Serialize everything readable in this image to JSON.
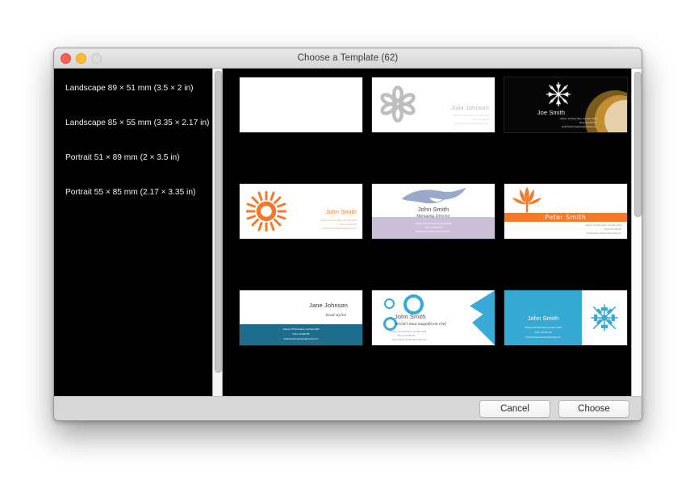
{
  "window": {
    "title": "Choose a Template (62)",
    "traffic_lights": [
      "close-button",
      "minimize-button",
      "zoom-button"
    ]
  },
  "sidebar": {
    "items": [
      {
        "label": "Landscape 89 × 51 mm (3.5 × 2 in)"
      },
      {
        "label": "Landscape 85 × 55 mm (3.35 × 2.17 in)"
      },
      {
        "label": "Portrait 51 × 89 mm (2 × 3.5 in)"
      },
      {
        "label": "Portrait 55 × 85 mm (2.17 × 3.35 in)"
      }
    ]
  },
  "common": {
    "address": "Address:  123 Street Name, City State 12345",
    "phone": "Phone: 123-456-789",
    "email": "Email: firstname.lastname@company.com"
  },
  "templates": [
    {
      "id": "blank",
      "name": "",
      "subtitle": "",
      "icon": "none",
      "accent": "#ffffff"
    },
    {
      "id": "julia-flower",
      "name": "Julia Johnson",
      "subtitle": "",
      "icon": "flower-icon",
      "accent": "#bcbcbc",
      "address": "Address:  123 Street Name, City State 12345",
      "phone": "Phone: 123-456-789",
      "email": "Email: firstname.lastname@company.com"
    },
    {
      "id": "joe-snowflake-dark",
      "name": "Joe Smith",
      "subtitle": "",
      "icon": "snowflake-icon",
      "accent": "#c79a44",
      "address": "Address:  123 Street Name, City State 12345",
      "phone": "Phone: 123-456-789",
      "email": "Email: firstname.lastname@company.com"
    },
    {
      "id": "john-sunburst",
      "name": "John Smith",
      "subtitle": "",
      "icon": "sunburst-icon",
      "accent": "#f0823c",
      "address": "Address:  123 Street Name, City State 12345",
      "phone": "Phone: 123-456-789",
      "email": "Email: firstname.lastname@company.com"
    },
    {
      "id": "john-feather-lavender",
      "name": "John Smith",
      "subtitle": "Managing Director",
      "icon": "feather-icon",
      "accent": "#ccbfd8",
      "address": "Address:  123 Street Name, City State 12345",
      "phone": "Phone: 123-456-789",
      "email": "Email: firstname.lastname@company.com"
    },
    {
      "id": "peter-lotus",
      "name": "Peter Smith",
      "subtitle": "",
      "icon": "lotus-icon",
      "accent": "#f4792a",
      "address": "Address:  123 Street Name, City State 12345",
      "phone": "Phone: 123-456-789",
      "email": "Email: firstname.lastname@company.com"
    },
    {
      "id": "jane-teal",
      "name": "Jane Johnson",
      "subtitle": "head stylist",
      "icon": "none",
      "accent": "#1d6e8c",
      "address": "Address:  123 Street Name, City State 12345",
      "phone": "Phone: 123-456-789",
      "email": "Email: firstname.lastname@company.com"
    },
    {
      "id": "john-circles-chef",
      "name": "John Smith",
      "subtitle": "World's most magnificent chef",
      "icon": "circles-icon",
      "accent": "#33aadd",
      "address": "Address:  123 Street Name, City State 12345",
      "phone": "Phone: 123-456-789",
      "email": "Email: firstname.lastname@company.com"
    },
    {
      "id": "john-blue-split-snowflake",
      "name": "John Smith",
      "subtitle": "",
      "icon": "snowflake-icon",
      "accent": "#37aad4",
      "address": "Address:  123 Street Name, City State 12345",
      "phone": "Phone: 123-456-789",
      "email": "Email: firstname.lastname@company.com"
    }
  ],
  "footer": {
    "cancel_label": "Cancel",
    "choose_label": "Choose"
  }
}
